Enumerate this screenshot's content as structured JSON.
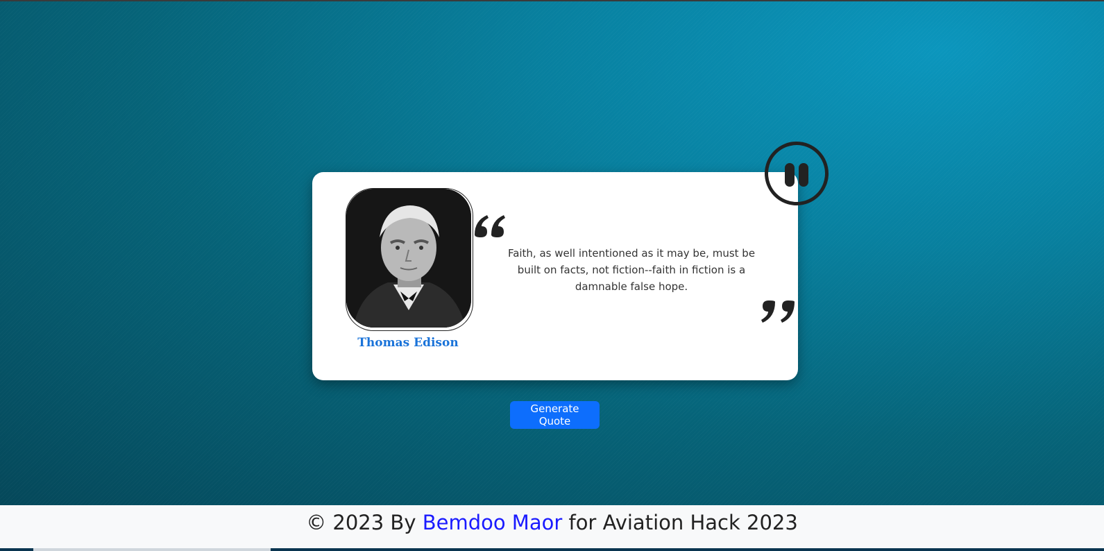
{
  "quote": {
    "author": "Thomas Edison",
    "text": "Faith, as well intentioned as it may be, must be built on facts, not fiction--faith in fiction is a damnable false hope."
  },
  "controls": {
    "generate_label": "Generate Quote",
    "pause_icon": "pause-icon"
  },
  "footer": {
    "prefix": "© 2023 By ",
    "author_link": "Bemdoo Maor",
    "suffix": " for Aviation Hack 2023"
  },
  "colors": {
    "accent": "#0d6efd",
    "author_name": "#1a73d9",
    "link": "#1a1aff"
  }
}
